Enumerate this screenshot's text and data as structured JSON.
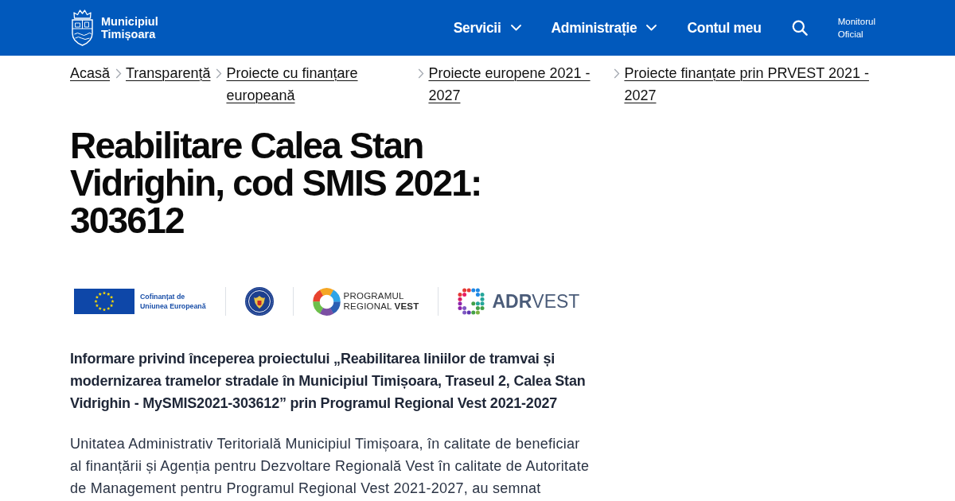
{
  "header": {
    "site_name": "Municipiul Timișoara",
    "nav": [
      {
        "label": "Servicii",
        "kind": "dropdown"
      },
      {
        "label": "Administrație",
        "kind": "dropdown"
      },
      {
        "label": "Contul meu",
        "kind": "link"
      }
    ],
    "monitor_link": "Monitorul Oficial"
  },
  "breadcrumbs": [
    "Acasă",
    "Transparență",
    "Proiecte cu finanțare europeană",
    "Proiecte europene 2021 - 2027",
    "Proiecte finanțate prin PRVEST 2021 - 2027"
  ],
  "title": "Reabilitare Calea Stan Vidrighin, cod SMIS 2021: 303612",
  "logos": [
    {
      "kind": "eu",
      "lines": [
        "Cofinanțat de",
        "Uniunea Europeană"
      ]
    },
    {
      "kind": "gov"
    },
    {
      "kind": "program",
      "lines": [
        "PROGRAMUL",
        "REGIONAL **VEST**"
      ]
    },
    {
      "kind": "agency",
      "lines": [
        "**ADR**VEST"
      ]
    }
  ],
  "lead": "Informare privind începerea proiectului „Reabilitarea liniilor de tramvai și modernizarea tramelor stradale în Municipiul Timișoara, Traseul 2, Calea Stan Vidrighin - MySMIS2021-303612” prin Programul Regional Vest 2021-2027",
  "body": "Unitatea Administrativ Teritorială Municipiul Timișoara, în calitate de beneficiar al finanțării și Agenția pentru Dezvoltare Regională Vest în calitate de Autoritate de Management pentru Programul Regional Vest 2021-2027, au semnat"
}
